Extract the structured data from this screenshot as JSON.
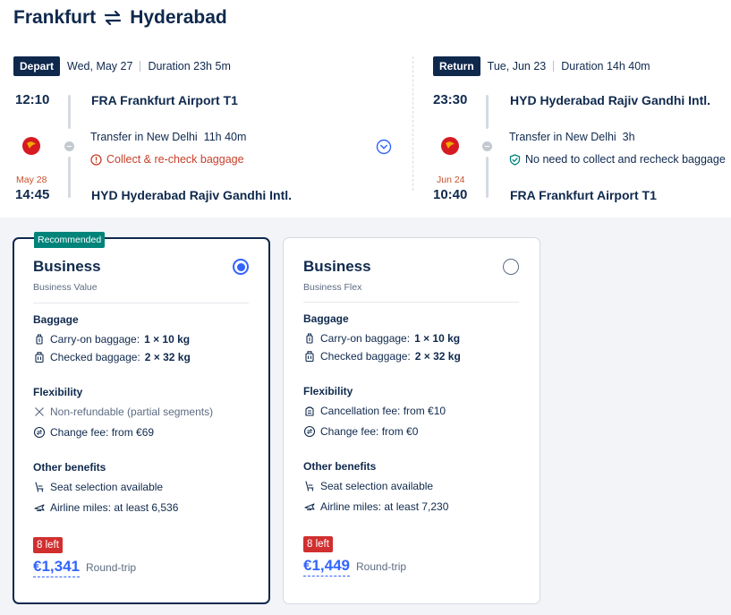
{
  "route": {
    "origin": "Frankfurt",
    "destination": "Hyderabad"
  },
  "depart": {
    "tag": "Depart",
    "date": "Wed, May 27",
    "duration": "Duration 23h 5m",
    "dep_time": "12:10",
    "dep_airport": "FRA Frankfurt Airport T1",
    "transfer": "Transfer in New Delhi",
    "transfer_time": "11h 40m",
    "baggage_note": "Collect & re-check baggage",
    "arr_date": "May 28",
    "arr_time": "14:45",
    "arr_airport": "HYD Hyderabad Rajiv Gandhi Intl."
  },
  "return": {
    "tag": "Return",
    "date": "Tue, Jun 23",
    "duration": "Duration 14h 40m",
    "dep_time": "23:30",
    "dep_airport": "HYD Hyderabad Rajiv Gandhi Intl.",
    "transfer": "Transfer in New Delhi",
    "transfer_time": "3h",
    "baggage_note": "No need to collect and recheck baggage",
    "arr_date": "Jun 24",
    "arr_time": "10:40",
    "arr_airport": "FRA Frankfurt Airport T1"
  },
  "cards": [
    {
      "badge": "Recommended",
      "cabin": "Business",
      "fare": "Business Value",
      "selected": true,
      "baggage_title": "Baggage",
      "carry_label": "Carry-on baggage:",
      "carry_value": "1 × 10 kg",
      "checked_label": "Checked baggage:",
      "checked_value": "2 × 32 kg",
      "flex_title": "Flexibility",
      "flex_1": "Non-refundable (partial segments)",
      "flex_2": "Change fee: from €69",
      "other_title": "Other benefits",
      "benefit_1": "Seat selection available",
      "benefit_2": "Airline miles: at least 6,536",
      "left": "8 left",
      "price": "€1,341",
      "price_note": "Round-trip"
    },
    {
      "cabin": "Business",
      "fare": "Business Flex",
      "selected": false,
      "baggage_title": "Baggage",
      "carry_label": "Carry-on baggage:",
      "carry_value": "1 × 10 kg",
      "checked_label": "Checked baggage:",
      "checked_value": "2 × 32 kg",
      "flex_title": "Flexibility",
      "flex_1": "Cancellation fee: from €10",
      "flex_2": "Change fee: from €0",
      "other_title": "Other benefits",
      "benefit_1": "Seat selection available",
      "benefit_2": "Airline miles: at least 7,230",
      "left": "8 left",
      "price": "€1,449",
      "price_note": "Round-trip"
    }
  ],
  "colors": {
    "navy": "#0f294d",
    "accent": "#3264ff",
    "warning": "#c7402a",
    "badge_green": "#00847a",
    "scarcity_red": "#d12f2f"
  }
}
